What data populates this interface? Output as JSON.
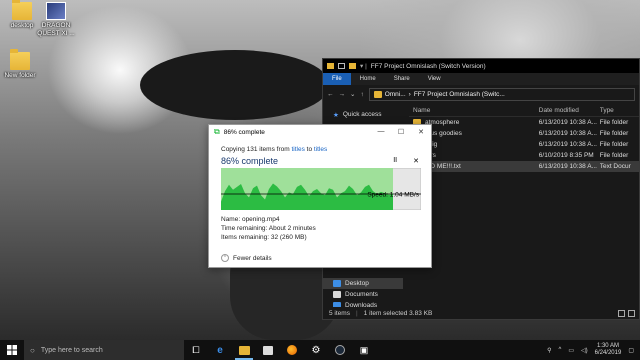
{
  "desktop": {
    "icons": [
      {
        "label": "desktop",
        "kind": "folder"
      },
      {
        "label": "DRAGON QUEST XI ...",
        "kind": "game"
      },
      {
        "label": "New folder",
        "kind": "folder"
      }
    ]
  },
  "explorer": {
    "title": "FF7 Project Omnislash (Switch Version)",
    "ribbon_tabs": [
      "File",
      "Home",
      "Share",
      "View"
    ],
    "address": [
      "Omni...",
      "FF7 Project Omnislash (Switc..."
    ],
    "nav_items": [
      {
        "label": "Quick access",
        "icon": "star-icon",
        "color": "#5aa0ff"
      },
      {
        "label": "Desktop",
        "icon": "desktop-icon",
        "color": "#3d8ee6"
      },
      {
        "label": "Documents",
        "icon": "documents-icon",
        "color": "#d9d9d9"
      },
      {
        "label": "Downloads",
        "icon": "downloads-icon",
        "color": "#3d8ee6"
      }
    ],
    "columns": {
      "name": "Name",
      "date": "Date modified",
      "type": "Type"
    },
    "rows": [
      {
        "name": "atmosphere",
        "date": "6/13/2019 10:38 A...",
        "type": "File folder",
        "kind": "folder"
      },
      {
        "name": "...us goodies",
        "date": "6/13/2019 10:38 A...",
        "type": "File folder",
        "kind": "folder"
      },
      {
        "name": "...fig",
        "date": "6/13/2019 10:38 A...",
        "type": "File folder",
        "kind": "folder"
      },
      {
        "name": "...rs",
        "date": "6/10/2019 8:35 PM",
        "type": "File folder",
        "kind": "folder"
      },
      {
        "name": "...D ME!!!.txt",
        "date": "6/13/2019 10:38 A...",
        "type": "Text Docur",
        "kind": "file",
        "selected": true
      }
    ],
    "status": {
      "items": "5 items",
      "selected": "1 item selected  3.83 KB"
    }
  },
  "copy_dialog": {
    "title": "86% complete",
    "copying_prefix": "Copying 131 items from ",
    "from": "titles",
    "to_word": " to ",
    "to": "titles",
    "percent_label": "86% complete",
    "progress": 0.86,
    "speed": "Speed: 1.04 MB/s",
    "name_line": "Name:  opening.mp4",
    "time_line": "Time remaining:  About 2 minutes",
    "items_line": "Items remaining:  32 (260 MB)",
    "fewer_details": "Fewer details",
    "pause_symbol": "II",
    "cancel_symbol": "✕",
    "colors": {
      "fill": "#06b025",
      "fill_light": "#cdeec6",
      "chart_bg": "#9fe09a",
      "title": "#1a3a6e"
    }
  },
  "chart_data": {
    "type": "area",
    "x": [
      0,
      1,
      2,
      3,
      4,
      5,
      6,
      7,
      8,
      9,
      10,
      11,
      12,
      13,
      14,
      15,
      16,
      17,
      18,
      19,
      20,
      21,
      22,
      23,
      24,
      25,
      26,
      27,
      28,
      29,
      30,
      31,
      32,
      33,
      34,
      35,
      36,
      37,
      38,
      39,
      40,
      41,
      42,
      43
    ],
    "values": [
      0.2,
      0.45,
      0.6,
      0.48,
      0.55,
      0.62,
      0.4,
      0.3,
      0.52,
      0.58,
      0.35,
      0.25,
      0.5,
      0.63,
      0.56,
      0.45,
      0.3,
      0.42,
      0.38,
      0.55,
      0.6,
      0.48,
      0.33,
      0.45,
      0.5,
      0.4,
      0.35,
      0.52,
      0.48,
      0.3,
      0.4,
      0.45,
      0.58,
      0.5,
      0.35,
      0.42,
      0.55,
      0.6,
      0.45,
      0.38,
      0.43,
      0.4,
      0.36,
      0.38
    ],
    "progress": 0.86,
    "speed": "Speed: 1.04 MB/s"
  },
  "taskbar": {
    "search_placeholder": "Type here to search",
    "apps": [
      "task-view",
      "edge",
      "file-explorer",
      "store",
      "firefox",
      "settings",
      "steam",
      "remote"
    ],
    "time": "1:30 AM",
    "date": "6/24/2019"
  }
}
